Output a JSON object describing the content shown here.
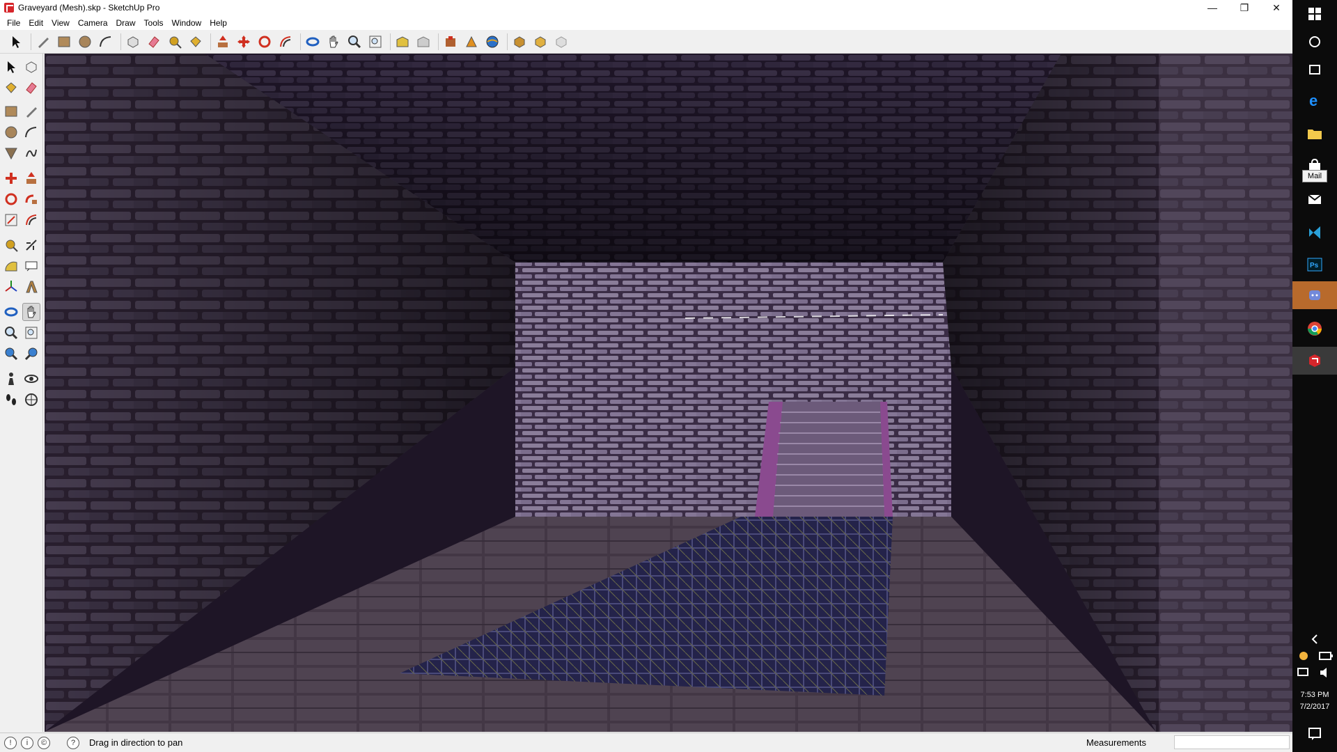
{
  "window": {
    "title": "Graveyard (Mesh).skp - SketchUp Pro",
    "minimize": "—",
    "restore": "❐",
    "close": "✕"
  },
  "menu": [
    "File",
    "Edit",
    "View",
    "Camera",
    "Draw",
    "Tools",
    "Window",
    "Help"
  ],
  "status": {
    "message": "Drag in direction to pan",
    "measurements_label": "Measurements",
    "measurements_value": ""
  },
  "taskbar": {
    "tooltip": "Mail",
    "time": "7:53 PM",
    "date": "7/2/2017"
  },
  "colors": {
    "accent": "#d6262b",
    "wall": "#3a2c45",
    "floor": "#5b4a5c",
    "carpet": "#2b2a52",
    "stairs": "#8a4a8f"
  }
}
